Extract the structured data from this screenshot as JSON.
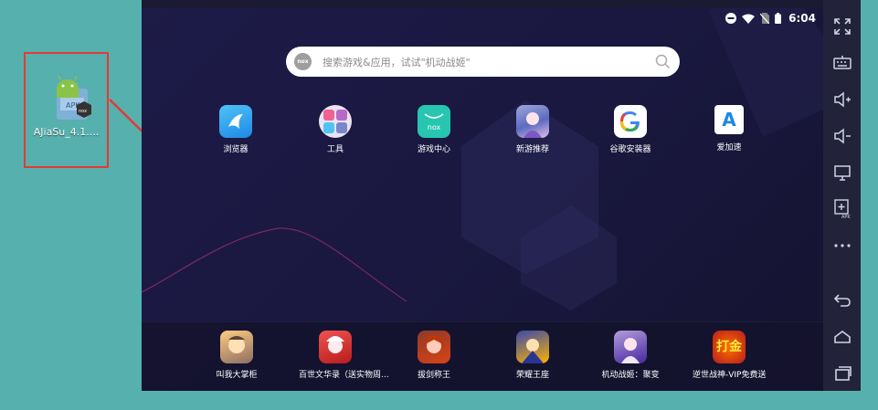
{
  "desktop": {
    "file_name": "AJiaSu_4.1....",
    "file_icon": "android-apk-icon"
  },
  "emulator": {
    "status": {
      "time": "6:04"
    },
    "search": {
      "logo": "nox",
      "placeholder": "搜索游戏&应用，试试\"机动战姬\""
    },
    "apps": [
      {
        "label": "浏览器",
        "icon": "browser-icon"
      },
      {
        "label": "工具",
        "icon": "tools-folder-icon"
      },
      {
        "label": "游戏中心",
        "icon": "game-center-icon"
      },
      {
        "label": "新游推荐",
        "icon": "new-games-icon"
      },
      {
        "label": "谷歌安装器",
        "icon": "google-installer-icon"
      },
      {
        "label": "爱加速",
        "icon": "aijiasu-icon"
      }
    ],
    "apps_logos": {
      "game_center": "nox",
      "aijiasu": "A"
    },
    "dock": [
      {
        "label": "叫我大掌柜",
        "icon": "game-icon"
      },
      {
        "label": "百世文华录（送实物周...",
        "icon": "game-icon"
      },
      {
        "label": "拔剑称王",
        "icon": "game-icon"
      },
      {
        "label": "荣耀王座",
        "icon": "game-icon"
      },
      {
        "label": "机动战姬：聚变",
        "icon": "game-icon"
      },
      {
        "label": "逆世战神-VIP免费送",
        "icon": "game-icon"
      }
    ],
    "dock_badge_text": "打金",
    "toolbar": [
      "fullscreen-icon",
      "keyboard-icon",
      "volume-up-icon",
      "volume-down-icon",
      "screen-icon",
      "apk-install-icon",
      "more-icon",
      "back-icon",
      "home-icon",
      "recents-icon"
    ]
  },
  "colors": {
    "desktop_bg": "#56b0ae",
    "highlight_border": "#e53935",
    "screen_bg": "#1d1b47",
    "toolbar_bg": "#22223a"
  }
}
